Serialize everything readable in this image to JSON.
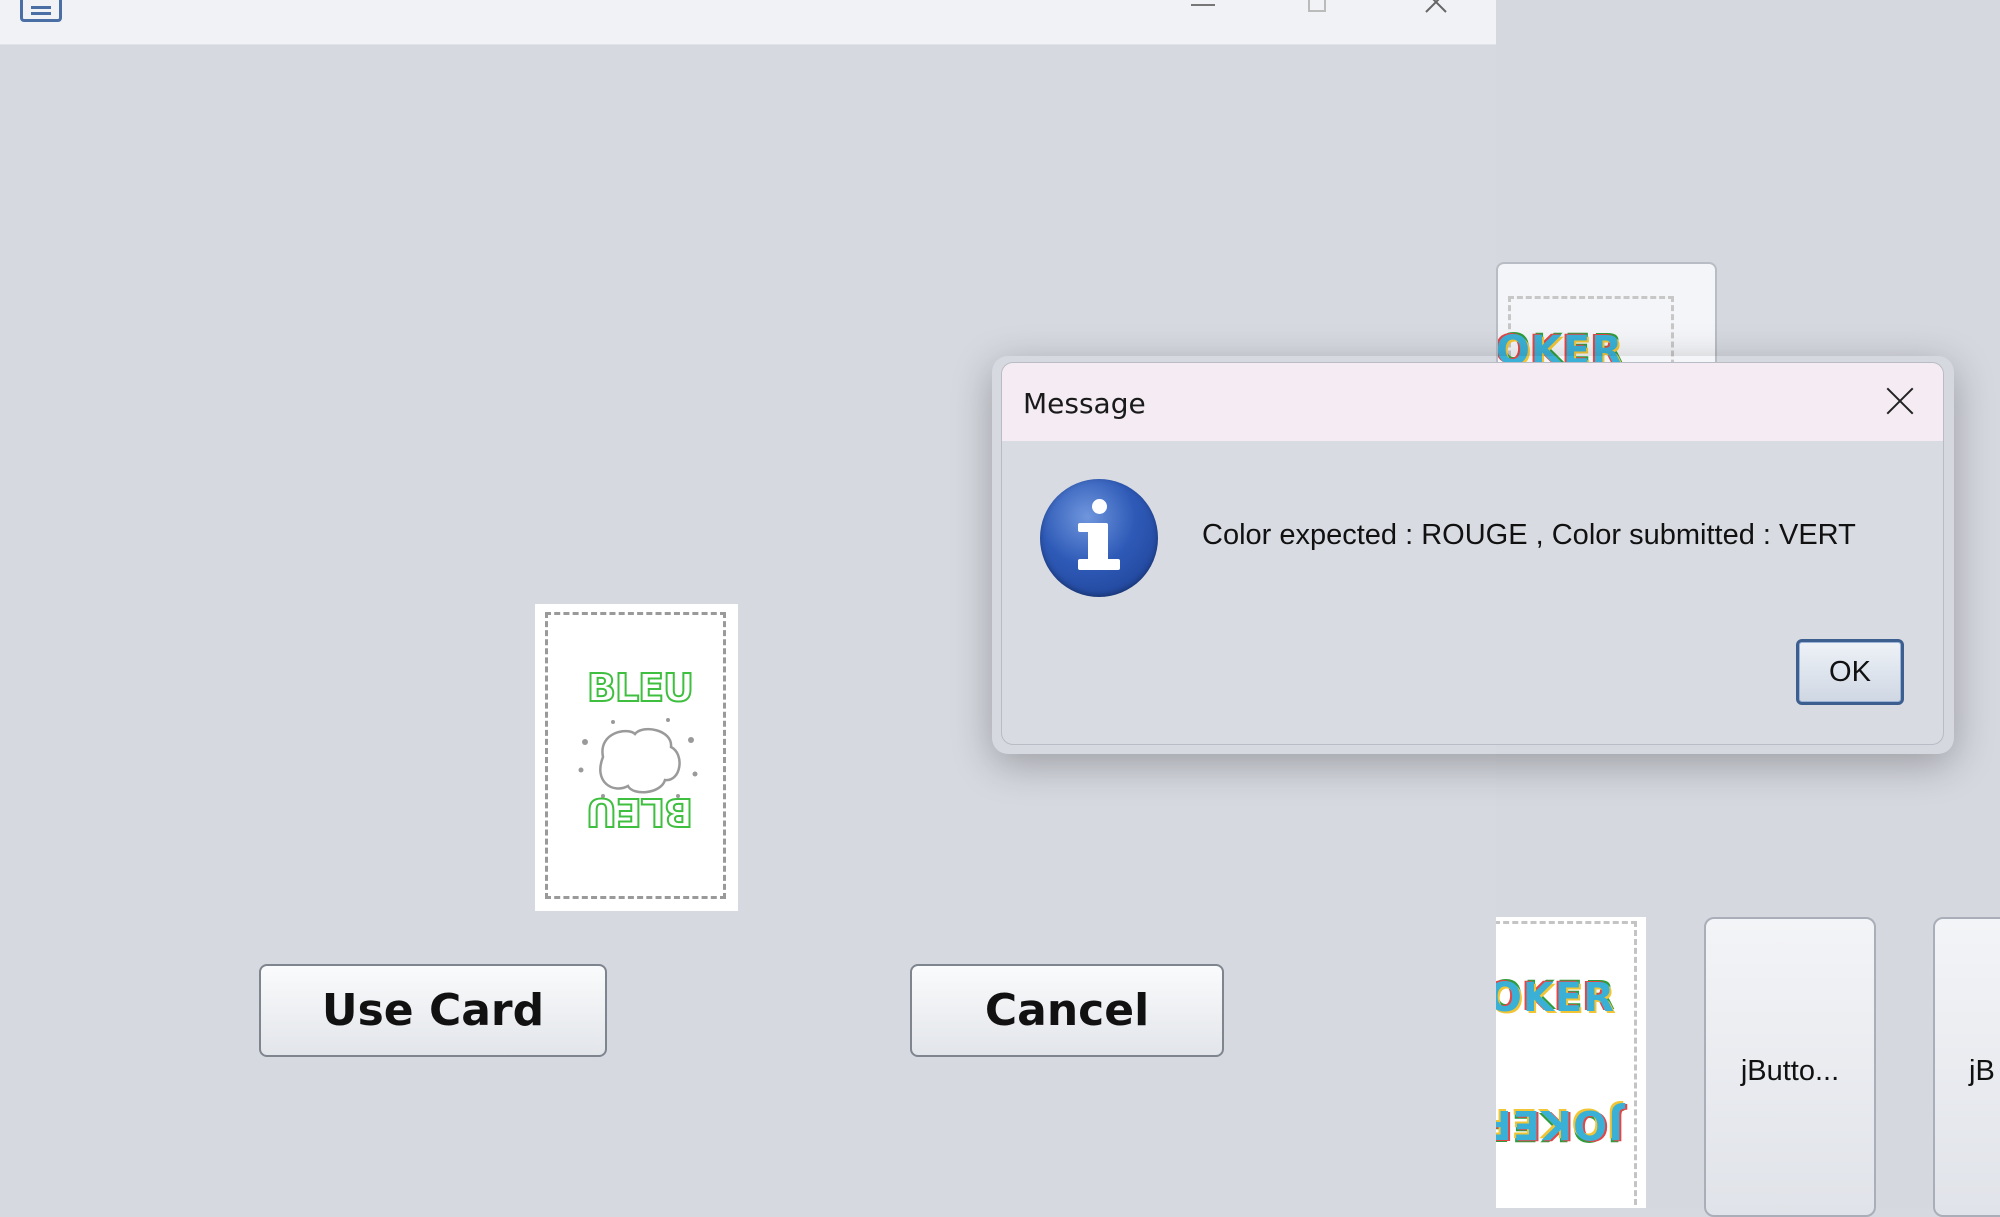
{
  "main_window": {
    "title": "",
    "card_preview": {
      "word_top": "BLEU",
      "word_bottom": "BLEU",
      "color_name": "BLEU"
    },
    "use_card_label": "Use Card",
    "cancel_label": "Cancel"
  },
  "background_window": {
    "card_top_label": "JOKER",
    "card_bottom_label": "JOKER",
    "card_bottom_label_flipped": "JOKER",
    "button_1_label": "jButto...",
    "button_2_label": "jB"
  },
  "dialog": {
    "title": "Message",
    "message": "Color expected : ROUGE  , Color submitted : VERT",
    "ok_label": "OK",
    "icon": "info-icon"
  },
  "colors": {
    "card_word": "#3fbf3f",
    "dialog_titlebar": "#f4ebf3",
    "info_icon": "#2e5ab7",
    "ok_border": "#3d5f8f"
  }
}
